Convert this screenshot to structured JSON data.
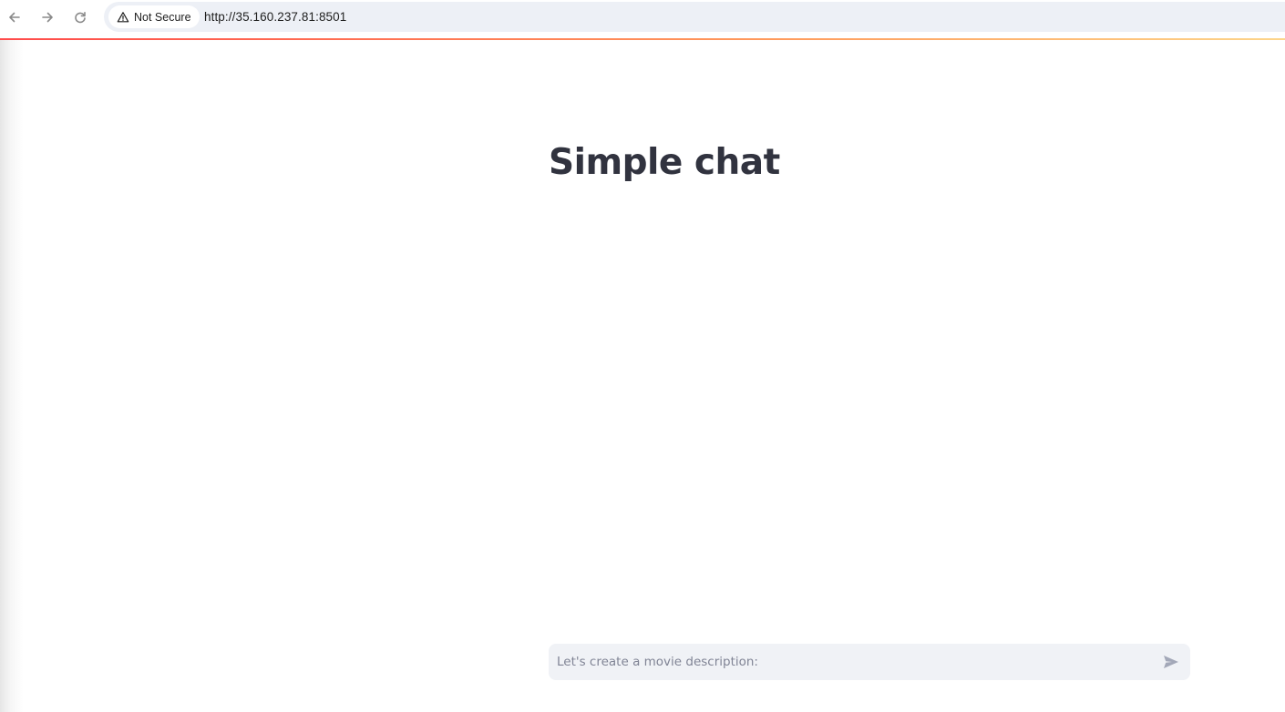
{
  "browser": {
    "security_label": "Not Secure",
    "url": "http://35.160.237.81:8501",
    "icons": {
      "back": "arrow-left-icon",
      "forward": "arrow-right-icon",
      "reload": "reload-icon",
      "security": "warning-triangle-icon"
    }
  },
  "page": {
    "title": "Simple chat"
  },
  "chat_input": {
    "placeholder": "Let's create a movie description:",
    "value": "",
    "send_icon": "send-icon"
  },
  "colors": {
    "accent_gradient_start": "#ff4b4b",
    "accent_gradient_end": "#fdd58a",
    "title_text": "#31333f",
    "input_background": "#f0f2f6"
  }
}
